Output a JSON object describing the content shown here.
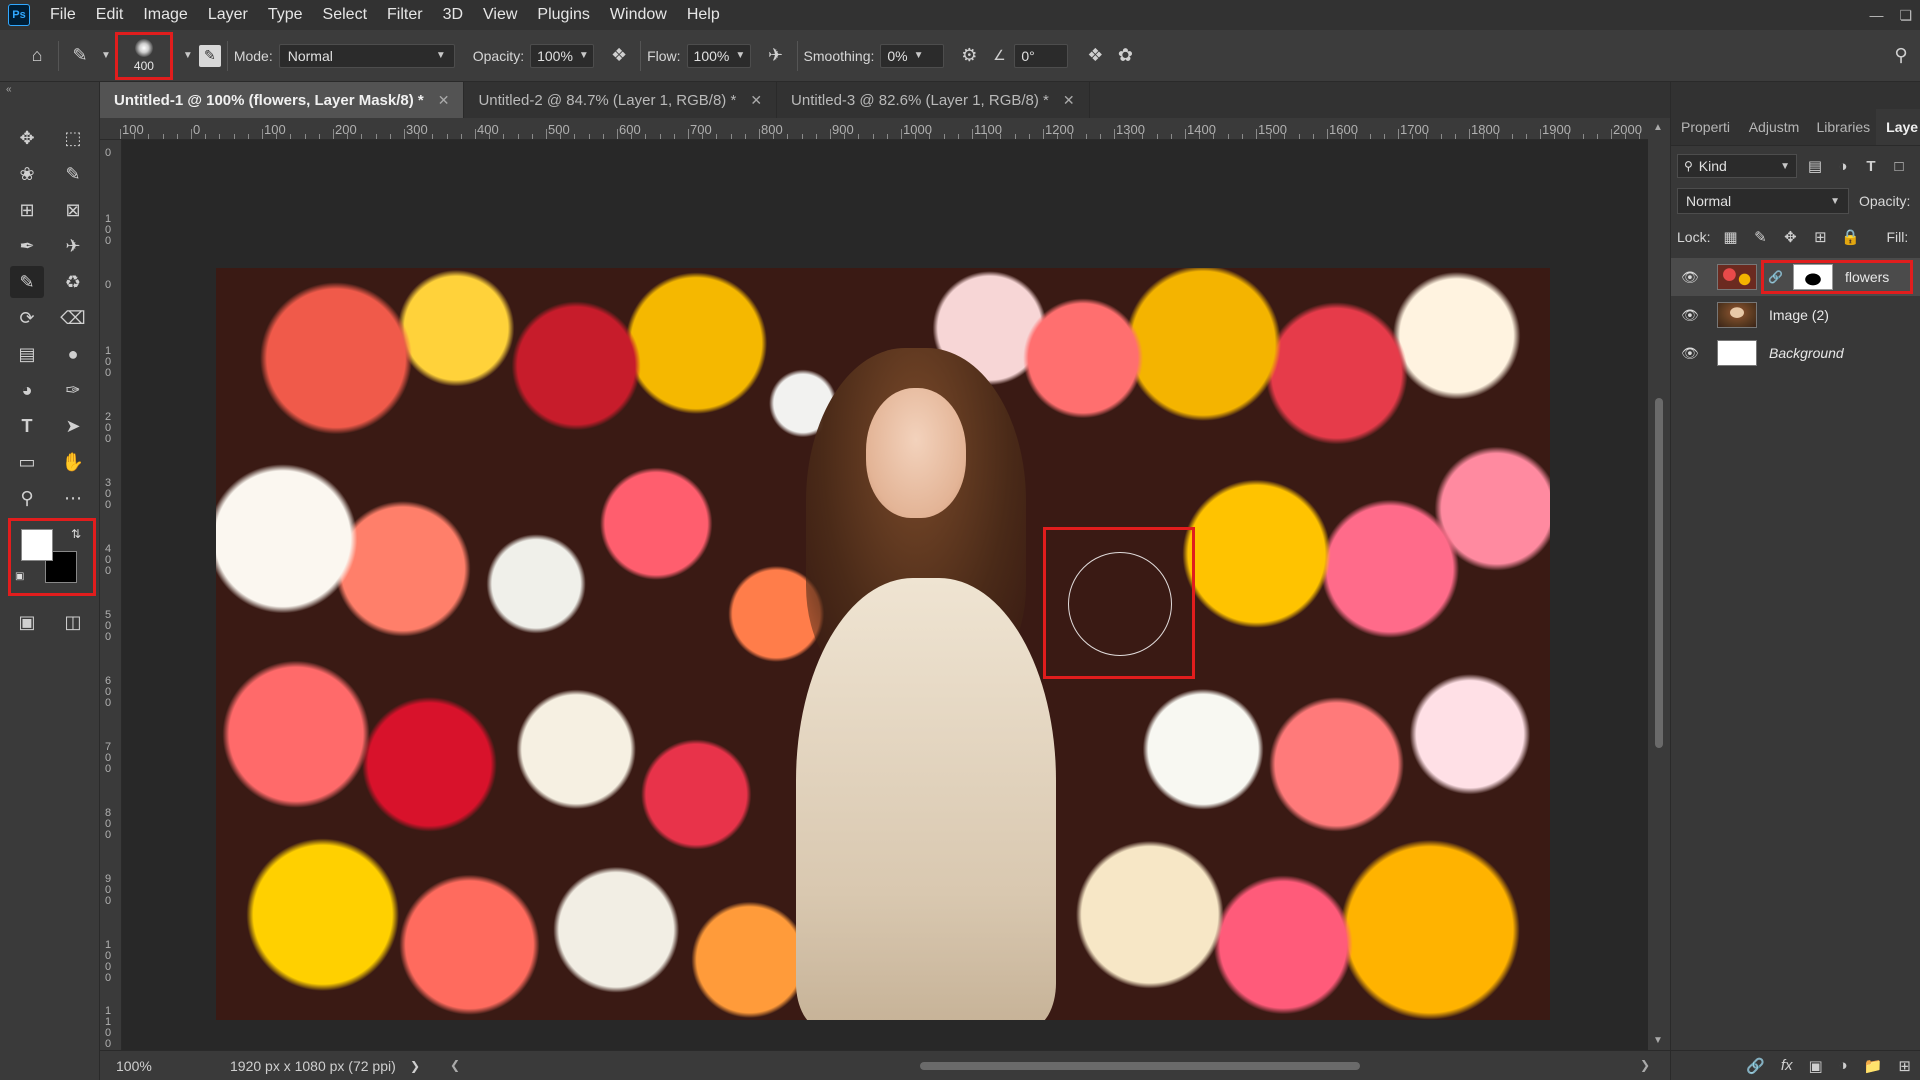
{
  "app": {
    "logo": "Ps"
  },
  "menu": [
    "File",
    "Edit",
    "Image",
    "Layer",
    "Type",
    "Select",
    "Filter",
    "3D",
    "View",
    "Plugins",
    "Window",
    "Help"
  ],
  "options_bar": {
    "brush_size": "400",
    "mode_label": "Mode:",
    "mode_value": "Normal",
    "opacity_label": "Opacity:",
    "opacity_value": "100%",
    "flow_label": "Flow:",
    "flow_value": "100%",
    "smoothing_label": "Smoothing:",
    "smoothing_value": "0%",
    "angle_value": "0°"
  },
  "tabs": [
    {
      "label": "Untitled-1 @ 100% (flowers, Layer Mask/8) *",
      "active": true
    },
    {
      "label": "Untitled-2 @ 84.7% (Layer 1, RGB/8) *",
      "active": false
    },
    {
      "label": "Untitled-3 @ 82.6% (Layer 1, RGB/8) *",
      "active": false
    }
  ],
  "ruler_top": [
    "100",
    "0",
    "100",
    "200",
    "300",
    "400",
    "500",
    "600",
    "700",
    "800",
    "900",
    "1000",
    "1100",
    "1200",
    "1300",
    "1400",
    "1500",
    "1600",
    "1700",
    "1800",
    "1900",
    "2000"
  ],
  "ruler_left": [
    "0",
    "100",
    "0",
    "100",
    "200",
    "300",
    "400",
    "500",
    "600",
    "700",
    "800",
    "900",
    "1000",
    "1100"
  ],
  "status": {
    "zoom": "100%",
    "doc_size": "1920 px x 1080 px (72 ppi)"
  },
  "colors": {
    "foreground": "#ffffff",
    "background": "#000000",
    "highlight": "#e11d1d"
  },
  "panel": {
    "tabs": [
      "Properti",
      "Adjustm",
      "Libraries",
      "Laye"
    ],
    "kind_label": "Kind",
    "blend_mode": "Normal",
    "opacity_label": "Opacity:",
    "lock_label": "Lock:",
    "fill_label": "Fill:",
    "layers": [
      {
        "name": "flowers",
        "italic": false,
        "has_mask": true,
        "selected": true
      },
      {
        "name": "Image (2)",
        "italic": false,
        "has_mask": false,
        "selected": false
      },
      {
        "name": "Background",
        "italic": true,
        "has_mask": false,
        "selected": false
      }
    ]
  }
}
